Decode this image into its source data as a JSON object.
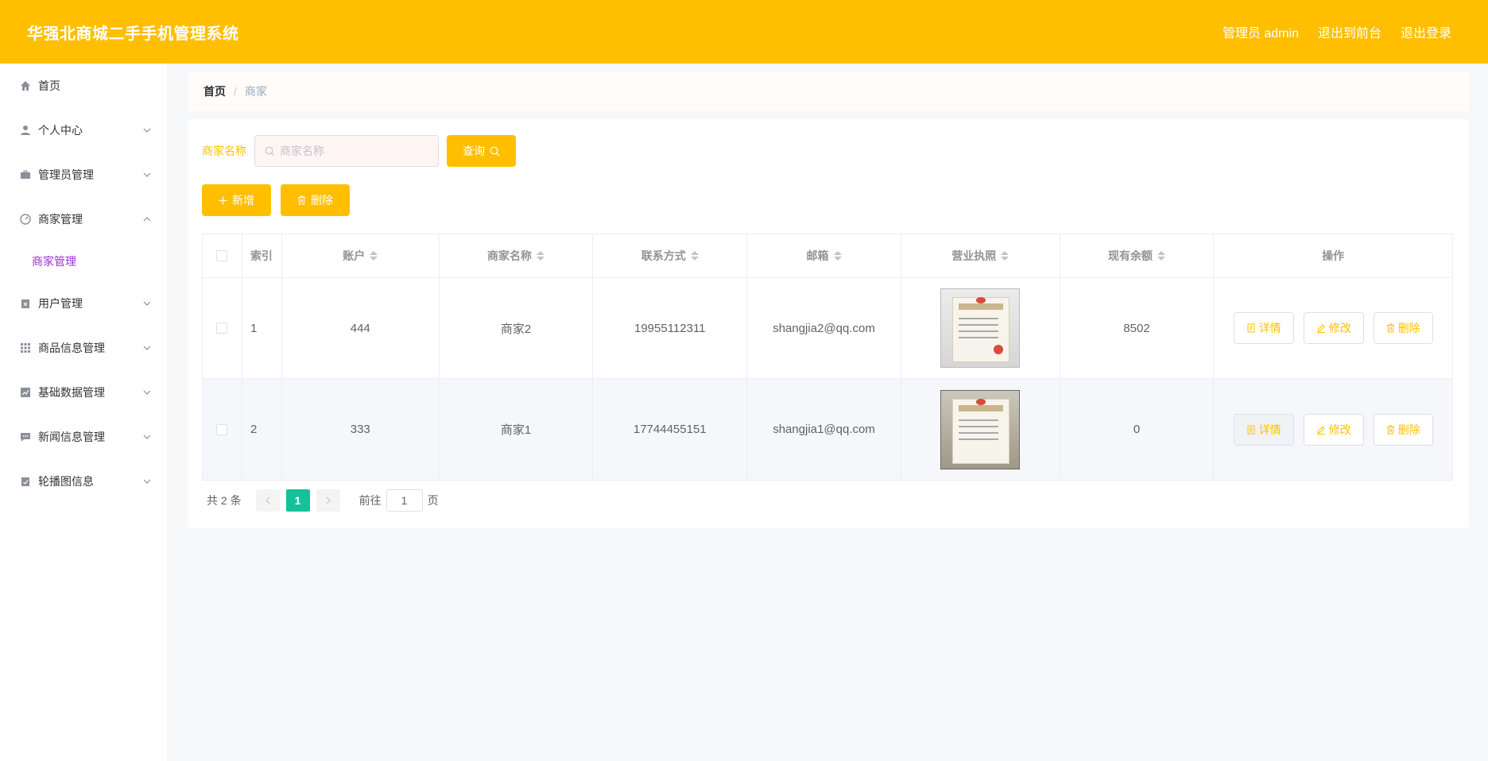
{
  "header": {
    "title": "华强北商城二手手机管理系统",
    "user_label": "管理员 admin",
    "to_front": "退出到前台",
    "logout": "退出登录"
  },
  "sidebar": {
    "items": [
      {
        "label": "首页",
        "icon": "home-icon"
      },
      {
        "label": "个人中心",
        "icon": "user-icon"
      },
      {
        "label": "管理员管理",
        "icon": "briefcase-icon"
      },
      {
        "label": "商家管理",
        "icon": "dashboard-icon"
      },
      {
        "label": "用户管理",
        "icon": "clipboard-icon"
      },
      {
        "label": "商品信息管理",
        "icon": "grid-icon"
      },
      {
        "label": "基础数据管理",
        "icon": "chart-icon"
      },
      {
        "label": "新闻信息管理",
        "icon": "message-icon"
      },
      {
        "label": "轮播图信息",
        "icon": "clipboard-check-icon"
      }
    ],
    "sub_active": "商家管理"
  },
  "breadcrumb": {
    "home": "首页",
    "sep": "/",
    "current": "商家"
  },
  "search": {
    "label": "商家名称",
    "placeholder": "商家名称",
    "query_button": "查询"
  },
  "actions": {
    "add": "新增",
    "delete": "删除"
  },
  "table": {
    "headers": {
      "index": "索引",
      "account": "账户",
      "name": "商家名称",
      "phone": "联系方式",
      "email": "邮箱",
      "license": "营业执照",
      "balance": "现有余额",
      "ops": "操作"
    },
    "rows": [
      {
        "index": "1",
        "account": "444",
        "name": "商家2",
        "phone": "19955112311",
        "email": "shangjia2@qq.com",
        "balance": "8502"
      },
      {
        "index": "2",
        "account": "333",
        "name": "商家1",
        "phone": "17744455151",
        "email": "shangjia1@qq.com",
        "balance": "0"
      }
    ],
    "op_labels": {
      "detail": "详情",
      "edit": "修改",
      "delete": "删除"
    }
  },
  "pagination": {
    "total": "共 2 条",
    "current": "1",
    "goto_prefix": "前往",
    "goto_value": "1",
    "goto_suffix": "页"
  },
  "colors": {
    "brand": "#ffbf00",
    "active_sub": "#9b2fd3",
    "page_active": "#13c29a"
  }
}
